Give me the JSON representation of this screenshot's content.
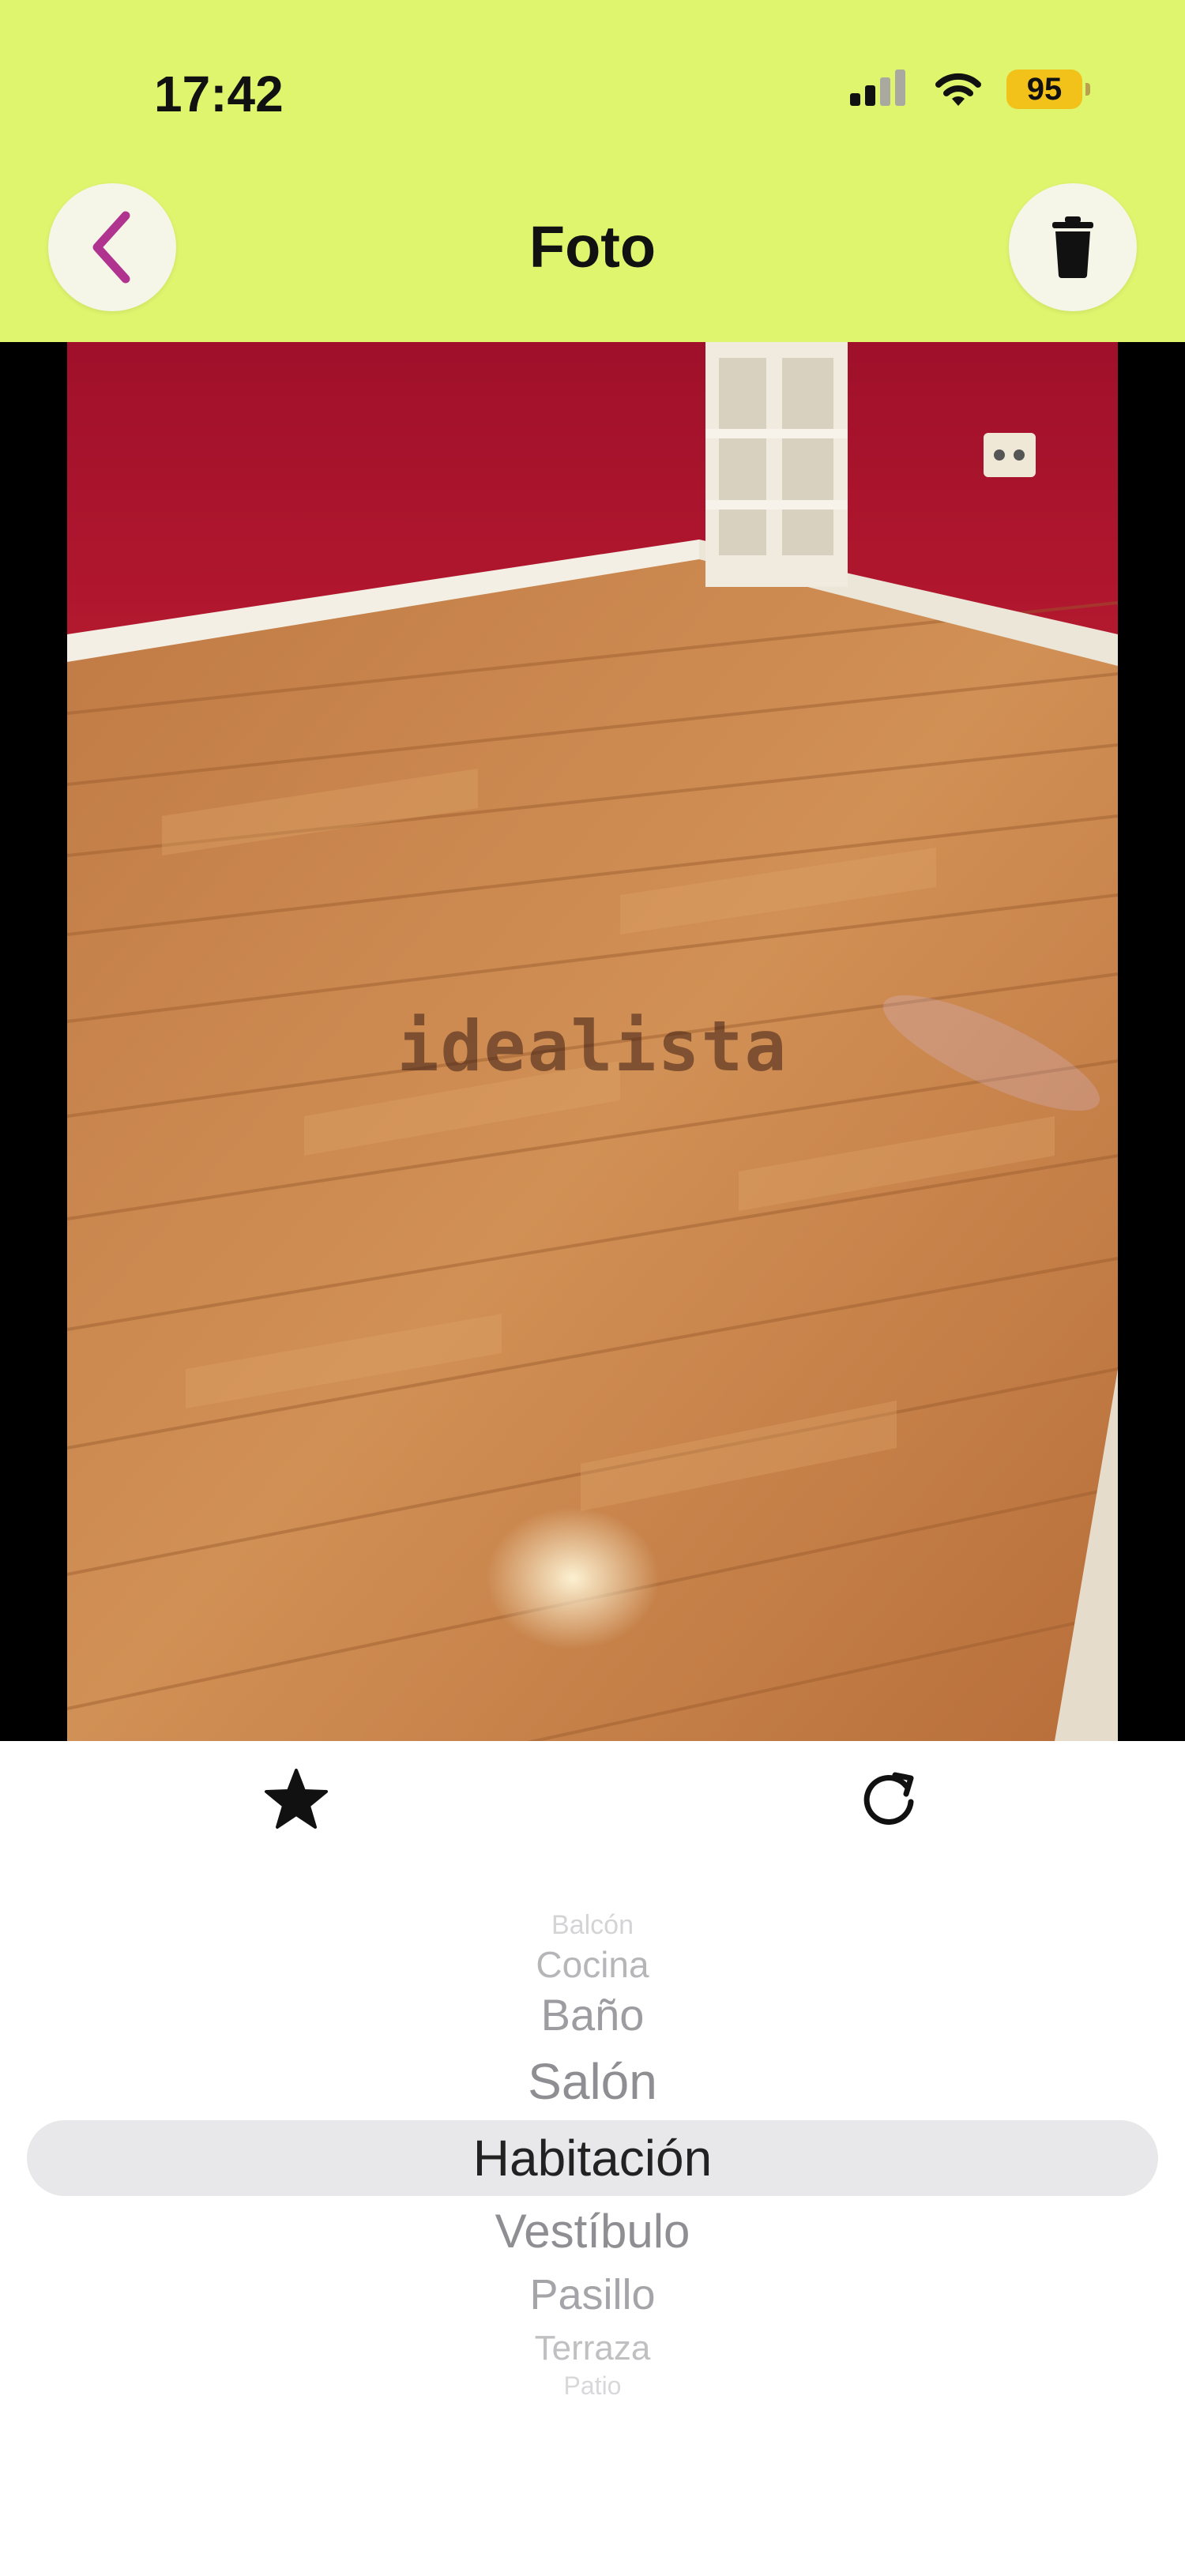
{
  "status_bar": {
    "time": "17:42",
    "battery": "95"
  },
  "header": {
    "title": "Foto",
    "background": "#dff56e",
    "back_icon": "chevron-left-icon",
    "trash_icon": "trash-icon"
  },
  "photo": {
    "watermark": "idealista"
  },
  "actions": {
    "favorite_icon": "star-icon",
    "rotate_icon": "rotate-icon"
  },
  "picker": {
    "items": [
      "Balcón",
      "Cocina",
      "Baño",
      "Salón",
      "Habitación",
      "Vestíbulo",
      "Pasillo",
      "Terraza",
      "Patio"
    ],
    "selected": "Habitación"
  },
  "colors": {
    "accent": "#b0348f",
    "header": "#dff56e",
    "battery": "#f2c21b"
  }
}
